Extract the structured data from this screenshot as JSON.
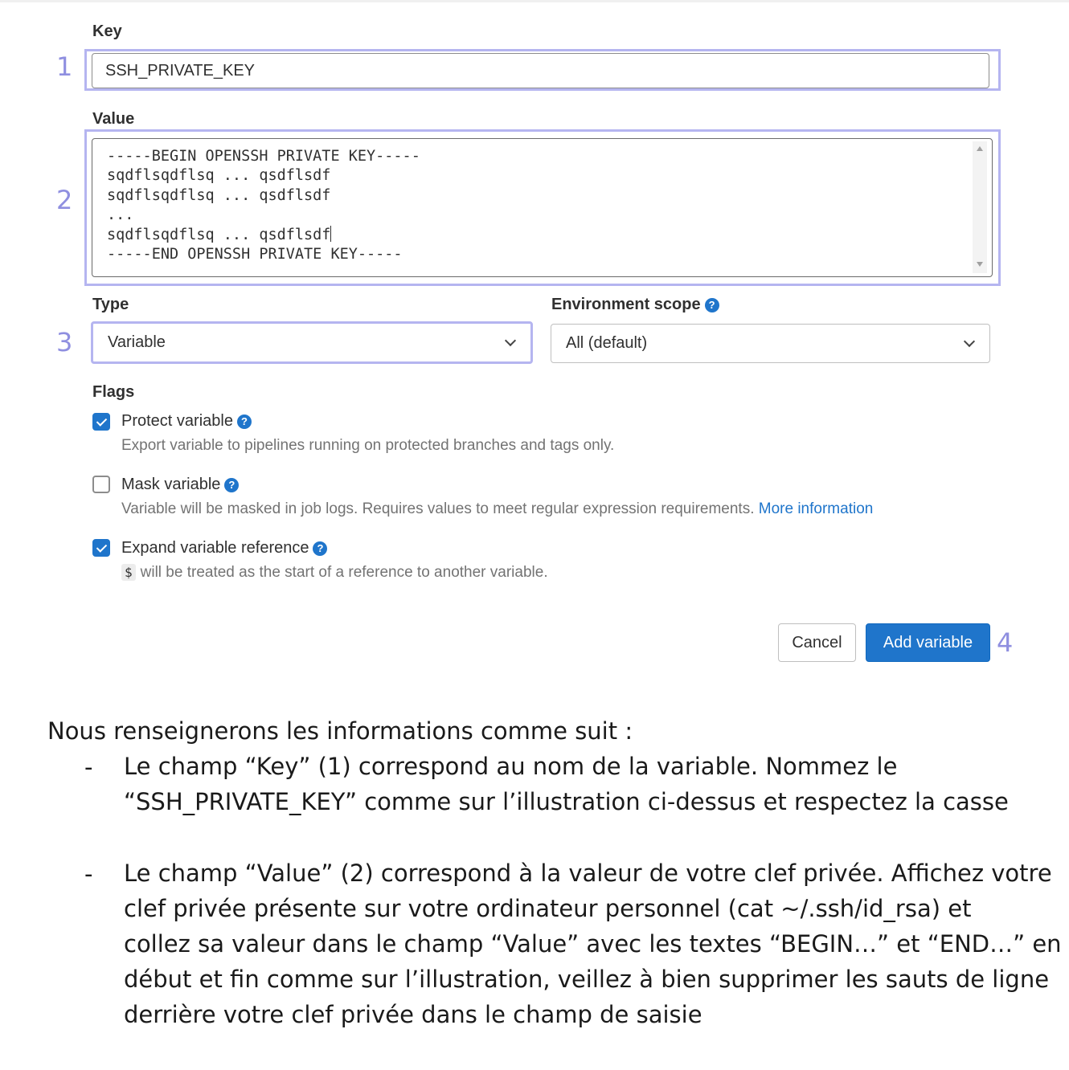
{
  "form": {
    "key": {
      "label": "Key",
      "value": "SSH_PRIVATE_KEY"
    },
    "value": {
      "label": "Value",
      "lines": [
        "-----BEGIN OPENSSH PRIVATE KEY-----",
        "sqdflsqdflsq ... qsdflsdf",
        "sqdflsqdflsq ... qsdflsdf",
        "...",
        "sqdflsqdflsq ... qsdflsdf",
        "-----END OPENSSH PRIVATE KEY-----"
      ]
    },
    "type": {
      "label": "Type",
      "value": "Variable"
    },
    "environment_scope": {
      "label": "Environment scope",
      "value": "All (default)"
    },
    "flags": {
      "label": "Flags",
      "protect": {
        "label": "Protect variable",
        "checked": true,
        "description": "Export variable to pipelines running on protected branches and tags only."
      },
      "mask": {
        "label": "Mask variable",
        "checked": false,
        "description": "Variable will be masked in job logs. Requires values to meet regular expression requirements.",
        "link": "More information"
      },
      "expand": {
        "label": "Expand variable reference",
        "checked": true,
        "code": "$",
        "description": "will be treated as the start of a reference to another variable."
      }
    },
    "buttons": {
      "cancel": "Cancel",
      "add": "Add variable"
    },
    "help_glyph": "?"
  },
  "annotations": {
    "n1": "1",
    "n2": "2",
    "n3": "3",
    "n4": "4"
  },
  "document": {
    "intro": "Nous renseignerons les informations comme suit :",
    "bullet": "-",
    "items": [
      {
        "lines": [
          "Le champ “Key” (1) correspond au nom de la variable. Nommez le",
          "“SSH_PRIVATE_KEY” comme sur l’illustration ci-dessus et respectez la casse"
        ]
      },
      {
        "lines": [
          "Le champ “Value” (2) correspond à la valeur de votre clef privée. Affichez votre",
          "clef privée présente sur votre ordinateur personnel (cat ~/.ssh/id_rsa) et",
          "collez sa valeur dans le champ “Value” avec les textes “BEGIN…” et “END…” en",
          "début et fin comme sur l’illustration, veillez à bien supprimer les sauts de ligne",
          "derrière votre clef privée dans le champ de saisie"
        ]
      }
    ]
  },
  "colors": {
    "accent": "#1f75cb",
    "annotation": "#8f8fe0",
    "highlight": "#b5b5f0"
  }
}
